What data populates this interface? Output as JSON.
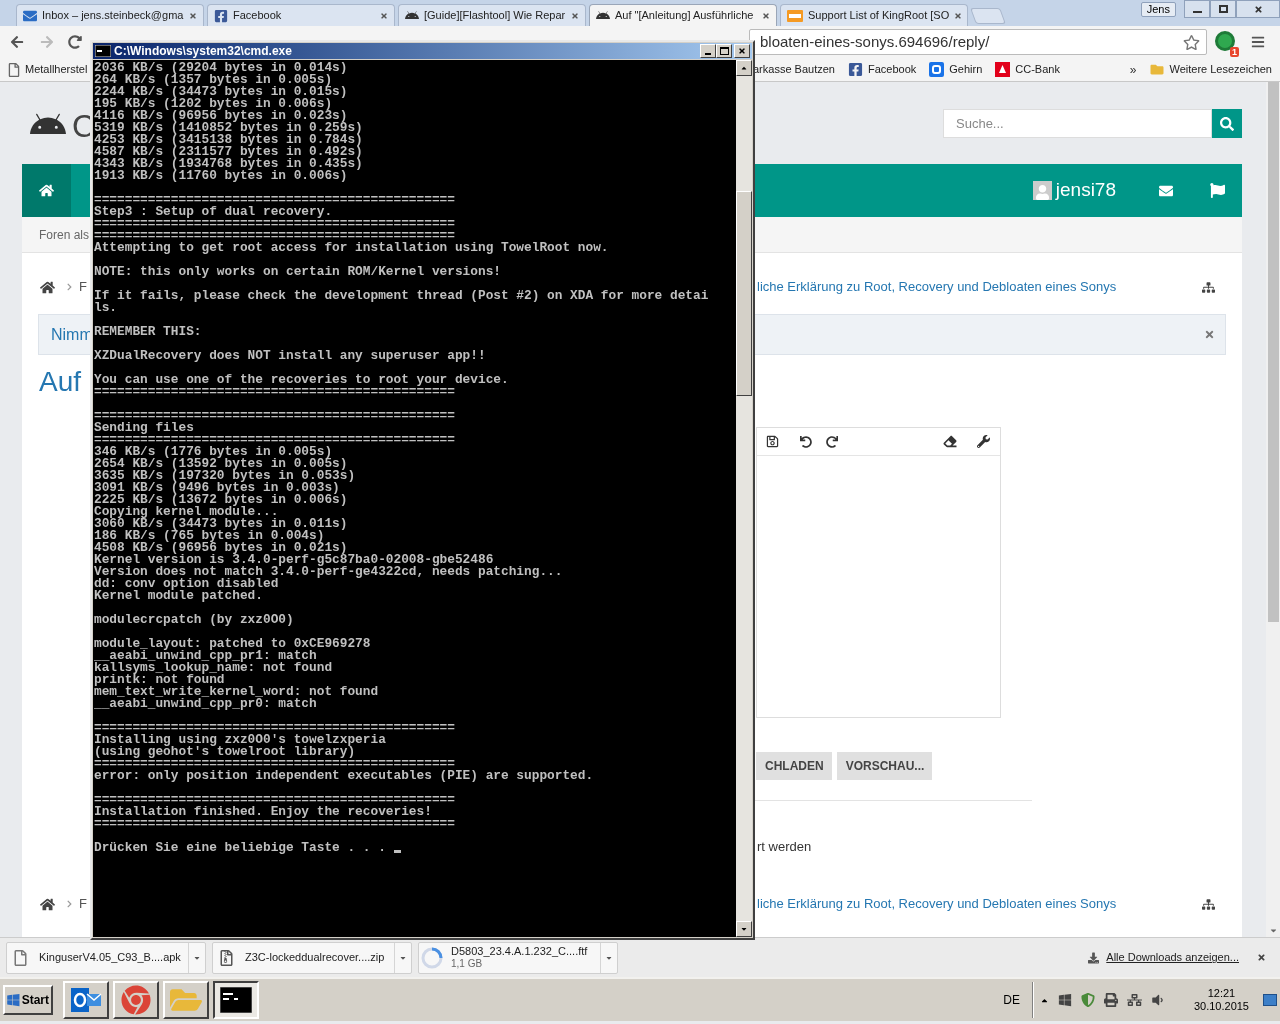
{
  "browser": {
    "tabs": [
      {
        "title": "Inbox – jens.steinbeck@gma",
        "kind": "mail",
        "selected": false
      },
      {
        "title": "Facebook",
        "kind": "facebook",
        "selected": false
      },
      {
        "title": "[Guide][Flashtool] Wie Repar",
        "kind": "android",
        "selected": false
      },
      {
        "title": "Auf \"[Anleitung] Ausführliche",
        "kind": "android",
        "selected": true
      },
      {
        "title": "Support List of KingRoot [SO",
        "kind": "xda",
        "selected": false
      }
    ],
    "profile": "Jens",
    "address": "bloaten-eines-sonys.694696/reply/",
    "extension_badge": "1",
    "bookmarks_left": [
      {
        "label": "Metallherstel",
        "kind": "page"
      }
    ],
    "bookmarks_right": [
      {
        "label": "arkasse Bautzen",
        "kind": "none"
      },
      {
        "label": "Facebook",
        "kind": "facebook"
      },
      {
        "label": "Gehirn",
        "kind": "gehirn"
      },
      {
        "label": "CC-Bank",
        "kind": "bank"
      }
    ],
    "overflow": "»",
    "other_bookmarks": "Weitere Lesezeichen"
  },
  "page": {
    "logo_letter": "C",
    "search": {
      "placeholder": "Suche..."
    },
    "username": "jensi78",
    "subnav": "Foren als",
    "breadcrumb_top": {
      "left": "F",
      "right": "liche Erklärung zu Root, Recovery und Debloaten eines Sonys"
    },
    "notice": "Nimm",
    "title": "Auf",
    "buttons": [
      "CHLADEN",
      "VORSCHAU..."
    ],
    "note": "rt werden",
    "breadcrumb_bottom": {
      "left": "F",
      "right": "liche Erklärung zu Root, Recovery und Debloaten eines Sonys"
    }
  },
  "cmd": {
    "title": "C:\\Windows\\system32\\cmd.exe",
    "lines": [
      {
        "kind": "text",
        "text": "2036 KB/s (29204 bytes in 0.014s)"
      },
      {
        "kind": "text",
        "text": "264 KB/s (1357 bytes in 0.005s)"
      },
      {
        "kind": "text",
        "text": "2244 KB/s (34473 bytes in 0.015s)"
      },
      {
        "kind": "text",
        "text": "195 KB/s (1202 bytes in 0.006s)"
      },
      {
        "kind": "text",
        "text": "4116 KB/s (96956 bytes in 0.023s)"
      },
      {
        "kind": "text",
        "text": "5319 KB/s (1410852 bytes in 0.259s)"
      },
      {
        "kind": "text",
        "text": "4253 KB/s (3415138 bytes in 0.784s)"
      },
      {
        "kind": "text",
        "text": "4587 KB/s (2311577 bytes in 0.492s)"
      },
      {
        "kind": "text",
        "text": "4343 KB/s (1934768 bytes in 0.435s)"
      },
      {
        "kind": "text",
        "text": "1913 KB/s (11760 bytes in 0.006s)"
      },
      {
        "kind": "blank"
      },
      {
        "kind": "text",
        "text": "==============================================="
      },
      {
        "kind": "text",
        "text": "Step3 : Setup of dual recovery."
      },
      {
        "kind": "text",
        "text": "==============================================="
      },
      {
        "kind": "text",
        "text": "==============================================="
      },
      {
        "kind": "text",
        "text": "Attempting to get root access for installation using TowelRoot now."
      },
      {
        "kind": "blank"
      },
      {
        "kind": "text",
        "text": "NOTE: this only works on certain ROM/Kernel versions!"
      },
      {
        "kind": "blank"
      },
      {
        "kind": "text",
        "text": "If it fails, please check the development thread (Post #2) on XDA for more detai"
      },
      {
        "kind": "text",
        "text": "ls."
      },
      {
        "kind": "blank"
      },
      {
        "kind": "text",
        "text": "REMEMBER THIS:"
      },
      {
        "kind": "blank"
      },
      {
        "kind": "text",
        "text": "XZDualRecovery does NOT install any superuser app!!"
      },
      {
        "kind": "blank"
      },
      {
        "kind": "text",
        "text": "You can use one of the recoveries to root your device."
      },
      {
        "kind": "text",
        "text": "==============================================="
      },
      {
        "kind": "blank"
      },
      {
        "kind": "text",
        "text": "==============================================="
      },
      {
        "kind": "text",
        "text": "Sending files"
      },
      {
        "kind": "text",
        "text": "==============================================="
      },
      {
        "kind": "text",
        "text": "346 KB/s (1776 bytes in 0.005s)"
      },
      {
        "kind": "text",
        "text": "2654 KB/s (13592 bytes in 0.005s)"
      },
      {
        "kind": "text",
        "text": "3635 KB/s (197320 bytes in 0.053s)"
      },
      {
        "kind": "text",
        "text": "3091 KB/s (9496 bytes in 0.003s)"
      },
      {
        "kind": "text",
        "text": "2225 KB/s (13672 bytes in 0.006s)"
      },
      {
        "kind": "text",
        "text": "Copying kernel module..."
      },
      {
        "kind": "text",
        "text": "3060 KB/s (34473 bytes in 0.011s)"
      },
      {
        "kind": "text",
        "text": "186 KB/s (765 bytes in 0.004s)"
      },
      {
        "kind": "text",
        "text": "4508 KB/s (96956 bytes in 0.021s)"
      },
      {
        "kind": "text",
        "text": "Kernel version is 3.4.0-perf-g5c87ba0-02008-gbe52486"
      },
      {
        "kind": "text",
        "text": "Version does not match 3.4.0-perf-ge4322cd, needs patching..."
      },
      {
        "kind": "text",
        "text": "dd: conv option disabled"
      },
      {
        "kind": "text",
        "text": "Kernel module patched."
      },
      {
        "kind": "blank"
      },
      {
        "kind": "text",
        "text": "modulecrcpatch (by zxz0O0)"
      },
      {
        "kind": "blank"
      },
      {
        "kind": "text",
        "text": "module_layout: patched to 0xCE969278"
      },
      {
        "kind": "text",
        "text": "__aeabi_unwind_cpp_pr1: match"
      },
      {
        "kind": "text",
        "text": "kallsyms_lookup_name: not found"
      },
      {
        "kind": "text",
        "text": "printk: not found"
      },
      {
        "kind": "text",
        "text": "mem_text_write_kernel_word: not found"
      },
      {
        "kind": "text",
        "text": "__aeabi_unwind_cpp_pr0: match"
      },
      {
        "kind": "blank"
      },
      {
        "kind": "text",
        "text": "==============================================="
      },
      {
        "kind": "text",
        "text": "Installing using zxz0O0's towelzxperia"
      },
      {
        "kind": "text",
        "text": "(using geohot's towelroot library)"
      },
      {
        "kind": "text",
        "text": "==============================================="
      },
      {
        "kind": "text",
        "text": "error: only position independent executables (PIE) are supported."
      },
      {
        "kind": "blank"
      },
      {
        "kind": "text",
        "text": "==============================================="
      },
      {
        "kind": "text",
        "text": "Installation finished. Enjoy the recoveries!"
      },
      {
        "kind": "text",
        "text": "==============================================="
      },
      {
        "kind": "blank"
      },
      {
        "kind": "prompt",
        "text": "Drücken Sie eine beliebige Taste . . ."
      }
    ]
  },
  "downloads": {
    "items": [
      {
        "name": "KinguserV4.05_C93_B....apk",
        "kind": "file"
      },
      {
        "name": "Z3C-lockeddualrecover....zip",
        "kind": "archive"
      },
      {
        "name": "D5803_23.4.A.1.232_C....ftf",
        "kind": "downloading",
        "size": "1,1 GB"
      }
    ],
    "show_all": "Alle Downloads anzeigen..."
  },
  "taskbar": {
    "start": "Start",
    "apps": [
      {
        "kind": "outlook",
        "selected": false
      },
      {
        "kind": "chrome",
        "selected": false
      },
      {
        "kind": "explorer",
        "selected": false
      },
      {
        "kind": "cmd",
        "selected": true
      }
    ],
    "language": "DE",
    "time": "12:21",
    "date": "30.10.2015"
  }
}
